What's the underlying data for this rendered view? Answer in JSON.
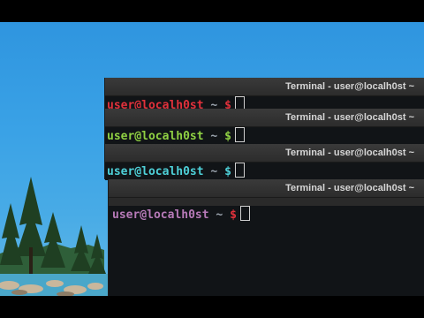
{
  "terminals": [
    {
      "title": "Terminal - user@localh0st ~",
      "prompt_user": "user@localh0st",
      "prompt_path": "~",
      "prompt_symbol": "$",
      "user_color": "#e0313b",
      "path_color": "#9aa3ad",
      "symbol_color": "#e0313b"
    },
    {
      "title": "Terminal - user@localh0st ~",
      "prompt_user": "user@localh0st",
      "prompt_path": "~",
      "prompt_symbol": "$",
      "user_color": "#8fd043",
      "path_color": "#9aa3ad",
      "symbol_color": "#8fd043"
    },
    {
      "title": "Terminal - user@localh0st ~",
      "prompt_user": "user@localh0st",
      "prompt_path": "~",
      "prompt_symbol": "$",
      "user_color": "#4ed0d8",
      "path_color": "#9aa3ad",
      "symbol_color": "#4ed0d8"
    },
    {
      "title": "Terminal - user@localh0st ~",
      "prompt_user": "user@localh0st",
      "prompt_path": "~",
      "prompt_symbol": "$",
      "user_color": "#b77ab8",
      "path_color": "#9aa3ad",
      "symbol_color": "#e0313b"
    }
  ],
  "wallpaper": {
    "sky_color": "#3aa2e6",
    "water_color": "#4aa7c9",
    "tree_color": "#1f3f22"
  }
}
